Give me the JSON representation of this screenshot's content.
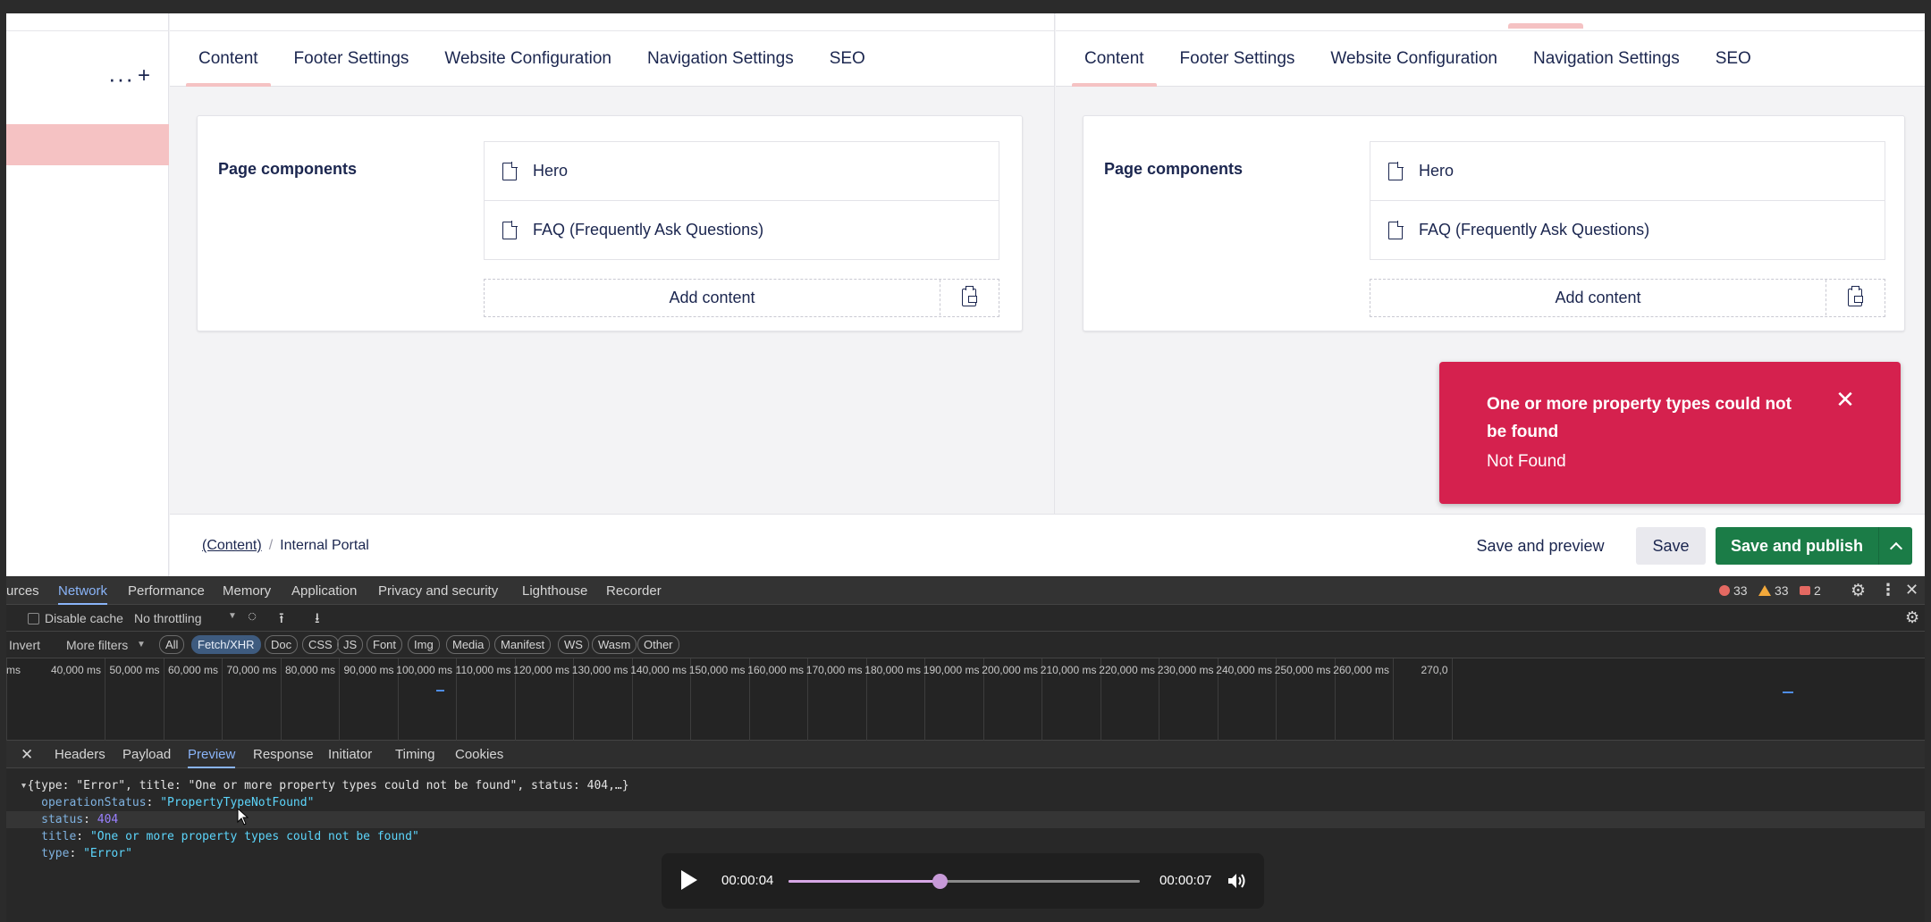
{
  "sidebar": {
    "more_icon": "more-dots-icon",
    "add_icon": "plus-icon"
  },
  "panes": [
    {
      "tabs": [
        "Content",
        "Footer Settings",
        "Website Configuration",
        "Navigation Settings",
        "SEO"
      ],
      "active_tab": 0,
      "card": {
        "label": "Page components",
        "components": [
          "Hero",
          "FAQ (Frequently Ask Questions)"
        ],
        "add_label": "Add content"
      }
    },
    {
      "tabs": [
        "Content",
        "Footer Settings",
        "Website Configuration",
        "Navigation Settings",
        "SEO"
      ],
      "active_tab": 0,
      "card": {
        "label": "Page components",
        "components": [
          "Hero",
          "FAQ (Frequently Ask Questions)"
        ],
        "add_label": "Add content"
      }
    }
  ],
  "toast": {
    "title": "One or more property types could not be found",
    "subtitle": "Not Found",
    "color": "#d5214e"
  },
  "footer": {
    "breadcrumb_link": "(Content)",
    "breadcrumb_sep": "/",
    "breadcrumb_current": "Internal Portal",
    "save_preview": "Save and preview",
    "save": "Save",
    "save_publish": "Save and publish",
    "publish_color": "#1b7c47"
  },
  "devtools": {
    "tabs": [
      "urces",
      "Network",
      "Performance",
      "Memory",
      "Application",
      "Privacy and security",
      "Lighthouse",
      "Recorder"
    ],
    "active_tab": "Network",
    "errors": "33",
    "warnings": "33",
    "issues": "2",
    "disable_cache": "Disable cache",
    "throttling": "No throttling",
    "invert": "Invert",
    "more_filters": "More filters",
    "filters": [
      "All",
      "Fetch/XHR",
      "Doc",
      "CSS",
      "JS",
      "Font",
      "Img",
      "Media",
      "Manifest",
      "WS",
      "Wasm",
      "Other"
    ],
    "active_filter": "Fetch/XHR",
    "timeline_ticks": [
      "ms",
      "40,000 ms",
      "50,000 ms",
      "60,000 ms",
      "70,000 ms",
      "80,000 ms",
      "90,000 ms",
      "100,000 ms",
      "110,000 ms",
      "120,000 ms",
      "130,000 ms",
      "140,000 ms",
      "150,000 ms",
      "160,000 ms",
      "170,000 ms",
      "180,000 ms",
      "190,000 ms",
      "200,000 ms",
      "210,000 ms",
      "220,000 ms",
      "230,000 ms",
      "240,000 ms",
      "250,000 ms",
      "260,000 ms",
      "270,0"
    ],
    "detail_tabs": [
      "Headers",
      "Payload",
      "Preview",
      "Response",
      "Initiator",
      "Timing",
      "Cookies"
    ],
    "active_detail_tab": "Preview",
    "preview": {
      "summary": "{type: \"Error\", title: \"One or more property types could not be found\", status: 404,…}",
      "lines": [
        {
          "key": "operationStatus",
          "value": "\"PropertyTypeNotFound\"",
          "kind": "s"
        },
        {
          "key": "status",
          "value": "404",
          "kind": "n"
        },
        {
          "key": "title",
          "value": "\"One or more property types could not be found\"",
          "kind": "s"
        },
        {
          "key": "type",
          "value": "\"Error\"",
          "kind": "s"
        }
      ]
    }
  },
  "player": {
    "current_time": "00:00:04",
    "duration": "00:00:07",
    "progress": 0.43
  }
}
